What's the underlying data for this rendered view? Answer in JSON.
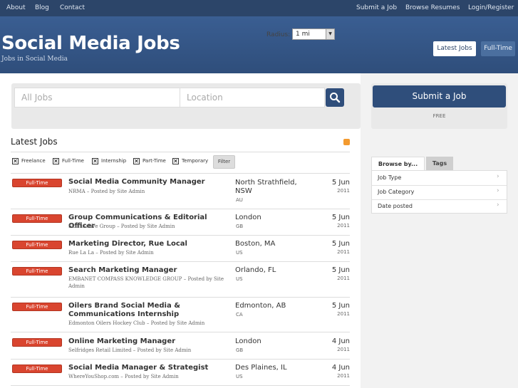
{
  "nav": {
    "left": [
      "About",
      "Blog",
      "Contact"
    ],
    "right": [
      "Submit a Job",
      "Browse Resumes",
      "Login/Register"
    ]
  },
  "header": {
    "title": "Social Media Jobs",
    "tagline": "Jobs in Social Media",
    "latest_btn": "Latest Jobs",
    "fulltime_btn": "Full-Time"
  },
  "search": {
    "jobs_placeholder": "All Jobs",
    "location_placeholder": "Location",
    "radius_label": "Radius:",
    "radius_value": "1 mi"
  },
  "listing": {
    "title": "Latest Jobs",
    "filters": [
      "Freelance",
      "Full-Time",
      "Internship",
      "Part-Time",
      "Temporary"
    ],
    "filter_btn": "Filter",
    "jobs": [
      {
        "type": "Full-Time",
        "title": "Social Media Community Manager",
        "company": "NRMA",
        "poster": "Site Admin",
        "location": "North Strathfield, NSW",
        "country": "AU",
        "date": "5 Jun",
        "year": "2011"
      },
      {
        "type": "Full-Time",
        "title": "Group Communications & Editorial Officer",
        "company": "SkillsActive Group",
        "poster": "Site Admin",
        "location": "London",
        "country": "GB",
        "date": "5 Jun",
        "year": "2011"
      },
      {
        "type": "Full-Time",
        "title": "Marketing Director, Rue Local",
        "company": "Rue La La",
        "poster": "Site Admin",
        "location": "Boston, MA",
        "country": "US",
        "date": "5 Jun",
        "year": "2011"
      },
      {
        "type": "Full-Time",
        "title": "Search Marketing Manager",
        "company": "EMBANET COMPASS KNOWLEDGE GROUP",
        "poster": "Site Admin",
        "location": "Orlando, FL",
        "country": "US",
        "date": "5 Jun",
        "year": "2011"
      },
      {
        "type": "Full-Time",
        "title": "Oilers Brand Social Media & Communications Internship",
        "company": "Edmonton Oilers Hockey Club",
        "poster": "Site Admin",
        "location": "Edmonton, AB",
        "country": "CA",
        "date": "5 Jun",
        "year": "2011"
      },
      {
        "type": "Full-Time",
        "title": "Online Marketing Manager",
        "company": "Selfridges Retail Limited",
        "poster": "Site Admin",
        "location": "London",
        "country": "GB",
        "date": "4 Jun",
        "year": "2011"
      },
      {
        "type": "Full-Time",
        "title": "Social Media Manager & Strategist",
        "company": "WhereYouShop.com",
        "poster": "Site Admin",
        "location": "Des Plaines, IL",
        "country": "US",
        "date": "4 Jun",
        "year": "2011"
      }
    ],
    "posted_by": "Posted by"
  },
  "sidebar": {
    "submit_btn": "Submit a Job",
    "free_label": "FREE",
    "tab_browse": "Browse by...",
    "tab_tags": "Tags",
    "items": [
      "Job Type",
      "Job Category",
      "Date posted"
    ]
  },
  "colors": {
    "nav_bg": "#2c4569",
    "header_bg": "#3a5e92",
    "accent": "#2f4e7b",
    "badge": "#d9452f"
  }
}
